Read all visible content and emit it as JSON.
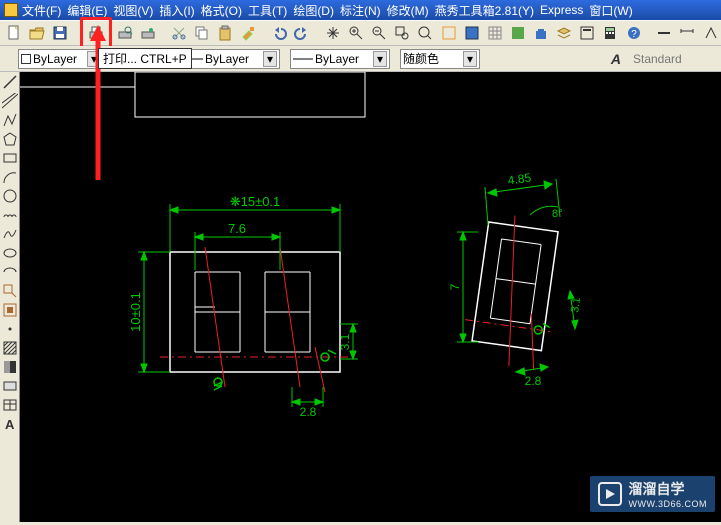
{
  "menu": {
    "file": "文件(F)",
    "edit": "编辑(E)",
    "view": "视图(V)",
    "insert": "插入(I)",
    "format": "格式(O)",
    "tools": "工具(T)",
    "draw": "绘图(D)",
    "dimension": "标注(N)",
    "modify": "修改(M)",
    "yanxiu": "燕秀工具箱2.81(Y)",
    "express": "Express",
    "window": "窗口(W)"
  },
  "tooltip": {
    "print": "打印...   CTRL+P"
  },
  "props": {
    "layer1": "ByLayer",
    "layer2": "ByLayer",
    "layer3": "ByLayer",
    "color": "随颜色",
    "style": "Standard"
  },
  "drawing": {
    "dim_main_w": "❋15±0.1",
    "dim_inner_w": "7.6",
    "dim_main_h": "10±0.1",
    "dim_small_h": "3.1",
    "dim_small_w": "2.8",
    "dim2_w": "4.85",
    "dim2_h": "7",
    "dim2_small_h": "3.1",
    "dim2_small_w": "2.8",
    "dim2_angle": "8°"
  },
  "watermark": {
    "brand": "溜溜自学",
    "url": "WWW.3D66.COM"
  },
  "lefttools": [
    "line-icon",
    "xline-icon",
    "pline-icon",
    "polygon-icon",
    "rect-icon",
    "arc-icon",
    "circle-icon",
    "revcloud-icon",
    "spline-icon",
    "ellipse-icon",
    "ellipsearc-icon",
    "insert-icon",
    "block-icon",
    "point-icon",
    "hatch-icon",
    "gradient-icon",
    "region-icon",
    "table-icon",
    "text-icon"
  ],
  "toolbar_icons": [
    "new-icon",
    "open-icon",
    "save-icon",
    "plot-icon",
    "plot-preview-icon",
    "publish-icon",
    "cut-icon",
    "match-icon",
    "copy-icon",
    "paste-icon",
    "paintbrush-icon",
    "undo-icon",
    "redo-icon",
    "pan-icon",
    "zoom-rt-icon",
    "zoom-prev-icon",
    "zoom-window-icon",
    "zoom-icon",
    "snap-icon",
    "ortho-icon",
    "grid-icon",
    "dwg-icon",
    "purge-icon",
    "layer-icon",
    "prop-icon",
    "calc-icon",
    "help-icon",
    "line-mode",
    "dim-icon",
    "angle-dim-icon"
  ]
}
